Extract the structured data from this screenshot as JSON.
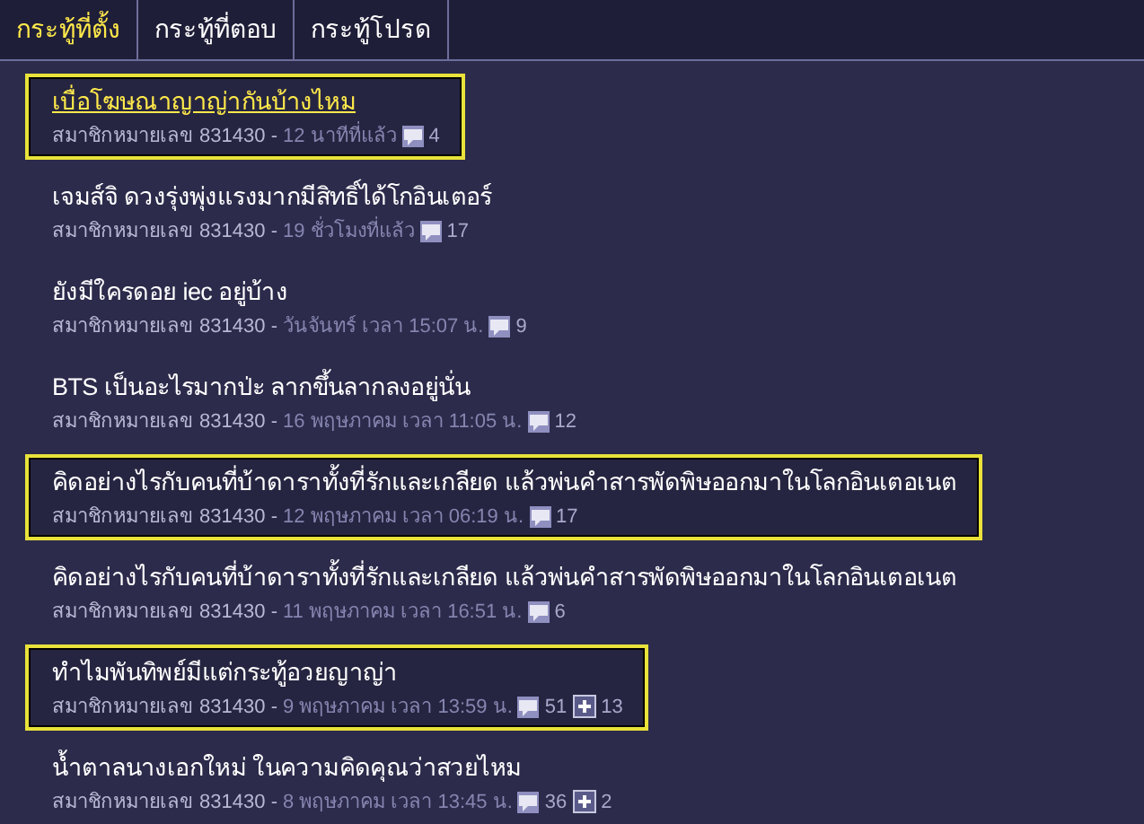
{
  "tabs": [
    {
      "label": "กระทู้ที่ตั้ง",
      "selected": true
    },
    {
      "label": "กระทู้ที่ตอบ",
      "selected": false
    },
    {
      "label": "กระทู้โปรด",
      "selected": false
    }
  ],
  "threads": [
    {
      "title": "เบื่อโฆษณาญาญ่ากันบ้างไหม",
      "member": "สมาชิกหมายเลข 831430 -",
      "time": "12 นาทีที่แล้ว",
      "comments": "4",
      "highlighted": true,
      "hover": true
    },
    {
      "title": "เจมส์จิ ดวงรุ่งพุ่งแรงมากมีสิทธิ์ได้โกอินเตอร์",
      "member": "สมาชิกหมายเลข 831430 -",
      "time": "19 ชั่วโมงที่แล้ว",
      "comments": "17",
      "highlighted": false,
      "hover": false
    },
    {
      "title": "ยังมีใครดอย iec อยู่บ้าง",
      "member": "สมาชิกหมายเลข 831430 -",
      "time": "วันจันทร์ เวลา 15:07 น.",
      "comments": "9",
      "highlighted": false,
      "hover": false
    },
    {
      "title": "BTS เป็นอะไรมากป่ะ ลากขึ้นลากลงอยู่นั่น",
      "member": "สมาชิกหมายเลข 831430 -",
      "time": "16 พฤษภาคม เวลา 11:05 น.",
      "comments": "12",
      "highlighted": false,
      "hover": false
    },
    {
      "title": "คิดอย่างไรกับคนที่บ้าดาราทั้งที่รักและเกลียด แล้วพ่นคำสารพัดพิษออกมาในโลกอินเตอเนต",
      "member": "สมาชิกหมายเลข 831430 -",
      "time": "12 พฤษภาคม เวลา 06:19 น.",
      "comments": "17",
      "highlighted": true,
      "hover": false
    },
    {
      "title": "คิดอย่างไรกับคนที่บ้าดาราทั้งที่รักและเกลียด แล้วพ่นคำสารพัดพิษออกมาในโลกอินเตอเนต",
      "member": "สมาชิกหมายเลข 831430 -",
      "time": "11 พฤษภาคม เวลา 16:51 น.",
      "comments": "6",
      "highlighted": false,
      "hover": false
    },
    {
      "title": "ทำไมพันทิพย์มีแต่กระทู้อวยญาญ่า",
      "member": "สมาชิกหมายเลข 831430 -",
      "time": "9 พฤษภาคม เวลา 13:59 น.",
      "comments": "51",
      "plus": "13",
      "highlighted": true,
      "hover": false
    },
    {
      "title": "น้ำตาลนางเอกใหม่ ในความคิดคุณว่าสวยไหม",
      "member": "สมาชิกหมายเลข 831430 -",
      "time": "8 พฤษภาคม เวลา 13:45 น.",
      "comments": "36",
      "plus": "2",
      "highlighted": false,
      "hover": false
    }
  ]
}
